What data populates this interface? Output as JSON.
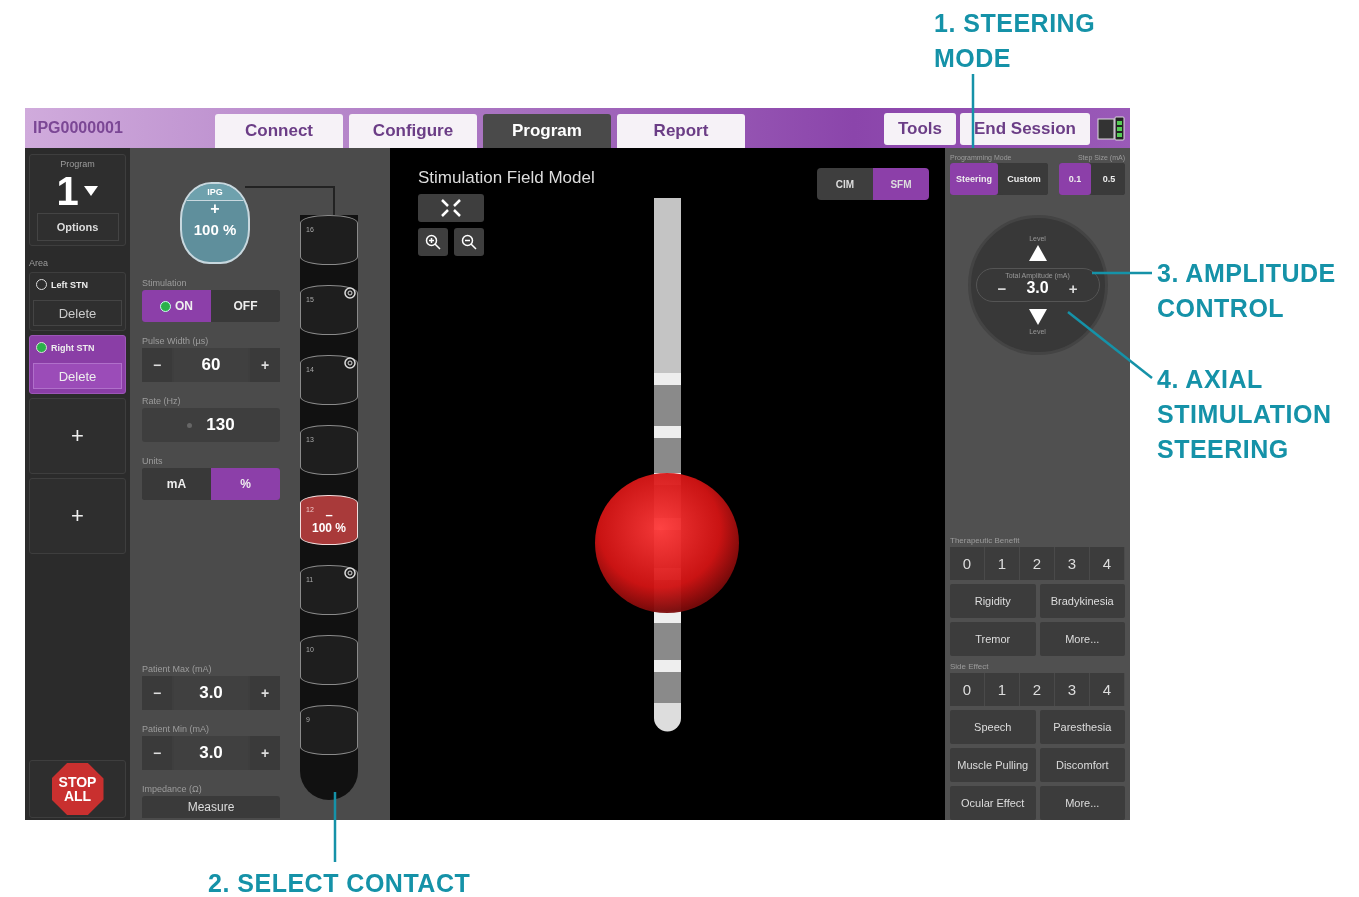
{
  "callouts": [
    {
      "text": "1. STEERING MODE"
    },
    {
      "text": "2. SELECT CONTACT"
    },
    {
      "text": "3. AMPLITUDE CONTROL"
    },
    {
      "text": "4. AXIAL STIMULATION STEERING"
    }
  ],
  "header": {
    "device_id": "IPG0000001",
    "tabs": [
      {
        "label": "Connect",
        "selected": false
      },
      {
        "label": "Configure",
        "selected": false
      },
      {
        "label": "Program",
        "selected": true
      },
      {
        "label": "Report",
        "selected": false
      }
    ],
    "actions": [
      "Tools",
      "End Session"
    ]
  },
  "sidebar": {
    "program_label": "Program",
    "program_number": "1",
    "options": "Options",
    "area_label": "Area",
    "areas": [
      {
        "name": "Left STN",
        "selected": false,
        "delete": "Delete"
      },
      {
        "name": "Right STN",
        "selected": true,
        "delete": "Delete"
      }
    ],
    "add_buttons": [
      "+",
      "+"
    ],
    "stop": "STOP ALL"
  },
  "settings": {
    "ipg": {
      "label": "IPG",
      "polarity": "+",
      "amplitude": "100 %"
    },
    "controls": [
      {
        "kind": "toggle",
        "label": "Stimulation",
        "options": [
          {
            "label": "ON",
            "selected": true
          },
          {
            "label": "OFF",
            "selected": false
          }
        ]
      },
      {
        "kind": "stepper",
        "label": "Pulse Width (µs)",
        "decrement": "−",
        "value": "60",
        "increment": "+"
      },
      {
        "kind": "value",
        "label": "Rate (Hz)",
        "value": "130"
      },
      {
        "kind": "toggle",
        "label": "Units",
        "options": [
          {
            "label": "mA",
            "selected": false
          },
          {
            "label": "%",
            "selected": true
          }
        ]
      }
    ],
    "limits": [
      {
        "kind": "stepper",
        "label": "Patient Max (mA)",
        "decrement": "−",
        "value": "3.0",
        "increment": "+"
      },
      {
        "kind": "stepper",
        "label": "Patient Min (mA)",
        "decrement": "−",
        "value": "3.0",
        "increment": "+"
      },
      {
        "kind": "button",
        "label": "Impedance (Ω)",
        "value": "Measure"
      }
    ]
  },
  "lead": {
    "contacts": [
      {
        "number": "16",
        "kind": "ring",
        "selected": false
      },
      {
        "number": "15",
        "kind": "segmented",
        "selected": false
      },
      {
        "number": "14",
        "kind": "segmented",
        "selected": false
      },
      {
        "number": "13",
        "kind": "ring",
        "selected": false
      },
      {
        "number": "12",
        "kind": "ring",
        "selected": true,
        "polarity": "–",
        "amplitude": "100 %"
      },
      {
        "number": "11",
        "kind": "segmented",
        "selected": false
      },
      {
        "number": "10",
        "kind": "ring",
        "selected": false
      },
      {
        "number": "9",
        "kind": "ring",
        "selected": false
      }
    ]
  },
  "viewer": {
    "title": "Stimulation Field Model",
    "modes": [
      {
        "label": "CIM",
        "selected": false
      },
      {
        "label": "SFM",
        "selected": true
      }
    ]
  },
  "steering": {
    "mode_label": "Programming Mode",
    "modes": [
      {
        "label": "Steering",
        "selected": true
      },
      {
        "label": "Custom",
        "selected": false
      }
    ],
    "step_label": "Step Size (mA)",
    "steps": [
      {
        "label": "0.1",
        "selected": true
      },
      {
        "label": "0.5",
        "selected": false
      }
    ],
    "dial": {
      "up_label": "Level",
      "amplitude_label": "Total Amplitude (mA)",
      "decrement": "−",
      "value": "3.0",
      "increment": "+",
      "down_label": "Level"
    }
  },
  "benefit": {
    "label": "Therapeutic Benefit",
    "ratings": [
      "0",
      "1",
      "2",
      "3",
      "4"
    ],
    "items": [
      "Rigidity",
      "Bradykinesia",
      "Tremor",
      "More..."
    ]
  },
  "side_effect": {
    "label": "Side Effect",
    "ratings": [
      "0",
      "1",
      "2",
      "3",
      "4"
    ],
    "items": [
      "Speech",
      "Paresthesia",
      "Muscle Pulling",
      "Discomfort",
      "Ocular Effect",
      "More..."
    ]
  }
}
